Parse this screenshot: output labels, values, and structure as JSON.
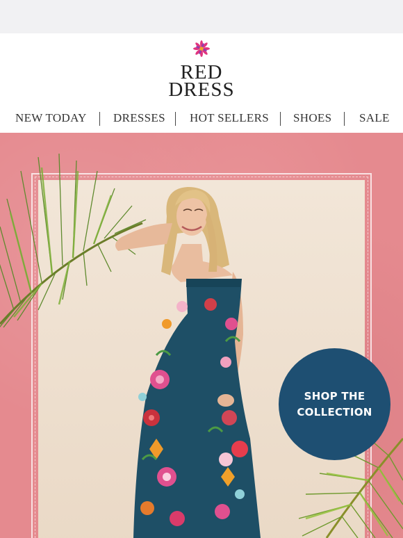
{
  "brand": {
    "line1": "RED",
    "line2": "DRESS",
    "logo_icon": "flower-logo-icon",
    "logo_colors": [
      "#e0357f",
      "#f0a02a",
      "#8a3fb0"
    ]
  },
  "nav": {
    "items": [
      {
        "label": "NEW TODAY"
      },
      {
        "label": "DRESSES"
      },
      {
        "label": "HOT SELLERS"
      },
      {
        "label": "SHOES"
      },
      {
        "label": "SALE"
      }
    ]
  },
  "hero": {
    "background_color": "#e58a8f",
    "cta": {
      "line1": "SHOP THE",
      "line2": "COLLECTION",
      "color": "#1e4f72"
    }
  }
}
